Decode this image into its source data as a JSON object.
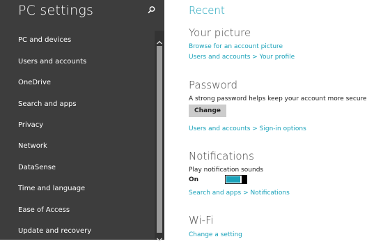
{
  "sidebar": {
    "title": "PC settings",
    "items": [
      {
        "label": "PC and devices"
      },
      {
        "label": "Users and accounts"
      },
      {
        "label": "OneDrive"
      },
      {
        "label": "Search and apps"
      },
      {
        "label": "Privacy"
      },
      {
        "label": "Network"
      },
      {
        "label": "DataSense"
      },
      {
        "label": "Time and language"
      },
      {
        "label": "Ease of Access"
      },
      {
        "label": "Update and recovery"
      }
    ]
  },
  "main": {
    "heading": "Recent",
    "picture": {
      "title": "Your picture",
      "link1": "Browse for an account picture",
      "link2": "Users and accounts > Your profile"
    },
    "password": {
      "title": "Password",
      "description": "A strong password helps keep your account more secure",
      "button": "Change",
      "link": "Users and accounts > Sign-in options"
    },
    "notifications": {
      "title": "Notifications",
      "label": "Play notification sounds",
      "toggle_state": "On",
      "toggle_on": true,
      "link": "Search and apps > Notifications"
    },
    "wifi": {
      "title": "Wi-Fi",
      "link": "Change a setting"
    }
  },
  "colors": {
    "sidebar_bg": "#3d3d3d",
    "accent": "#1aa2ba"
  },
  "icons": {
    "search": "search-icon",
    "scroll_up": "chevron-up-icon",
    "scroll_down": "chevron-down-icon"
  }
}
